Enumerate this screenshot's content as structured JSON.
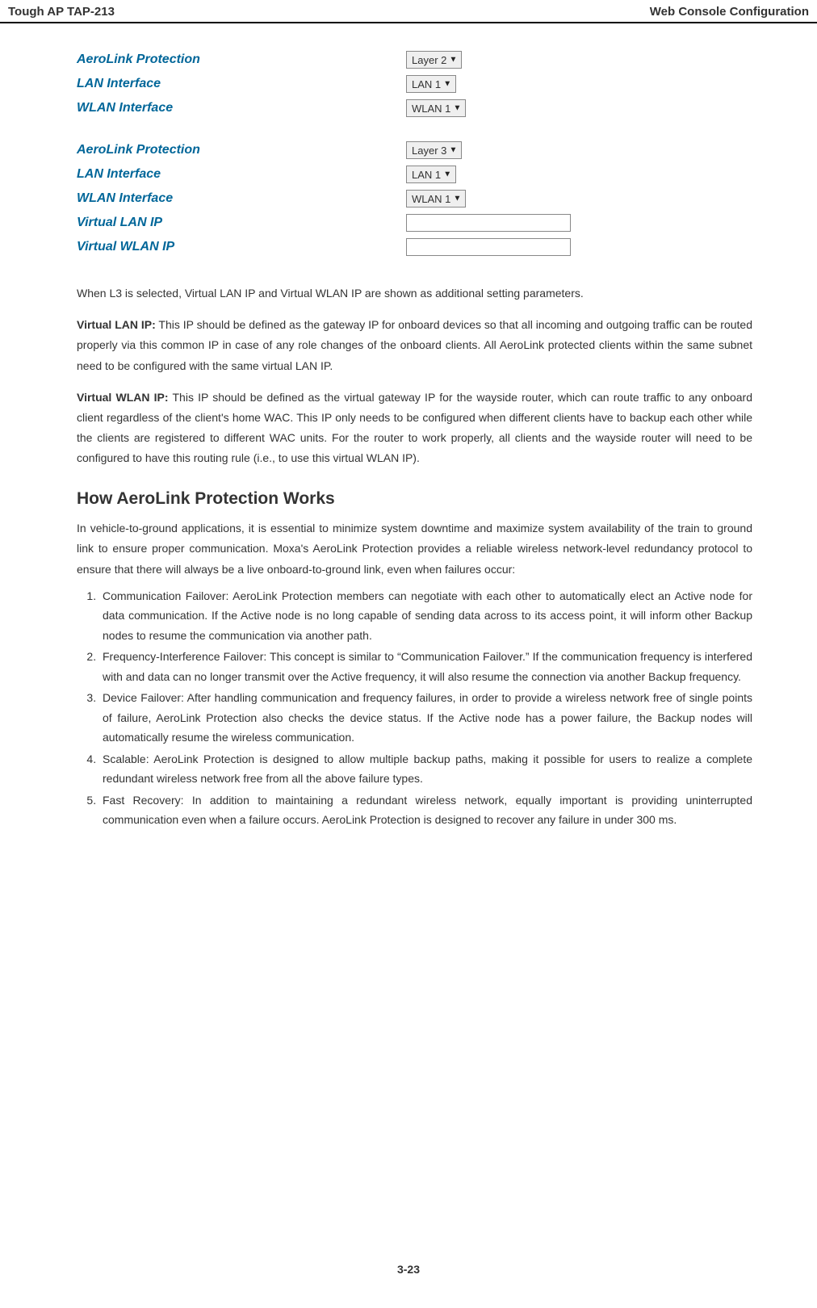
{
  "header": {
    "left": "Tough AP TAP-213",
    "right": "Web Console Configuration"
  },
  "form1": {
    "rows": [
      {
        "label": "AeroLink Protection",
        "type": "select",
        "value": "Layer 2"
      },
      {
        "label": "LAN Interface",
        "type": "select",
        "value": "LAN 1"
      },
      {
        "label": "WLAN Interface",
        "type": "select",
        "value": "WLAN 1"
      }
    ]
  },
  "form2": {
    "rows": [
      {
        "label": "AeroLink Protection",
        "type": "select",
        "value": "Layer 3"
      },
      {
        "label": "LAN Interface",
        "type": "select",
        "value": "LAN 1"
      },
      {
        "label": "WLAN Interface",
        "type": "select",
        "value": "WLAN 1"
      },
      {
        "label": "Virtual LAN IP",
        "type": "text",
        "value": ""
      },
      {
        "label": "Virtual WLAN IP",
        "type": "text",
        "value": ""
      }
    ]
  },
  "para_intro": "When L3 is selected, Virtual LAN IP and Virtual WLAN IP are shown as additional setting parameters.",
  "para_vlan_label": "Virtual LAN IP:",
  "para_vlan_text": " This IP should be defined as the gateway IP for onboard devices so that all incoming and outgoing traffic can be routed properly via this common IP in case of any role changes of the onboard clients. All AeroLink protected clients within the same subnet need to be configured with the same virtual LAN IP.",
  "para_vwlan_label": "Virtual WLAN IP:",
  "para_vwlan_text": " This IP should be defined as the virtual gateway IP for the wayside router, which can route traffic to any onboard client regardless of the client's home WAC. This IP only needs to be configured when different clients have to backup each other while the clients are registered to different WAC units. For the router to work properly, all clients and the wayside router will need to be configured to have this routing rule (i.e., to use this virtual WLAN IP).",
  "section_heading": "How AeroLink Protection Works",
  "section_para": "In vehicle-to-ground applications, it is essential to minimize system downtime and maximize system availability of the train to ground link to ensure proper communication. Moxa's AeroLink Protection provides a reliable wireless network-level redundancy protocol to ensure that there will always be a live onboard-to-ground link, even when failures occur:",
  "features": [
    "Communication Failover: AeroLink Protection members can negotiate with each other to automatically elect an Active node for data communication. If the Active node is no long capable of sending data across to its access point, it will inform other Backup nodes to resume the communication via another path.",
    "Frequency-Interference Failover: This concept is similar to “Communication Failover.” If the communication frequency is interfered with and data can no longer transmit over the Active frequency, it will also resume the connection via another Backup frequency.",
    "Device Failover: After handling communication and frequency failures, in order to provide a wireless network free of single points of failure, AeroLink Protection also checks the device status. If the Active node has a power failure, the Backup nodes will automatically resume the wireless communication.",
    "Scalable: AeroLink Protection is designed to allow multiple backup paths, making it possible for users to realize a complete redundant wireless network free from all the above failure types.",
    "Fast Recovery: In addition to maintaining a redundant wireless network, equally important is providing uninterrupted communication even when a failure occurs. AeroLink Protection is designed to recover any failure in under 300 ms."
  ],
  "footer": "3-23"
}
